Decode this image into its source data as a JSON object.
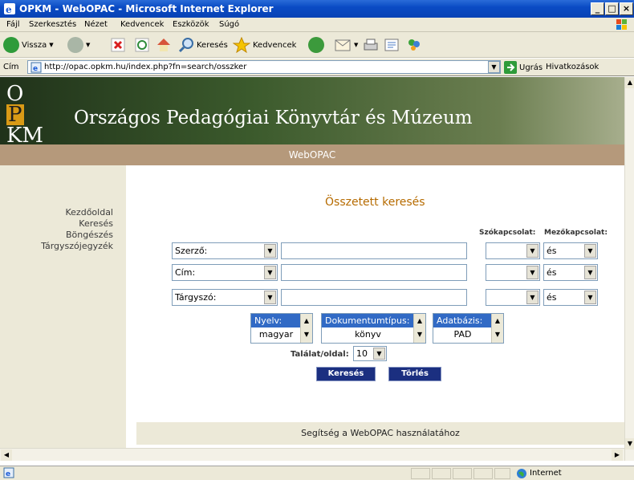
{
  "window": {
    "title": "OPKM - WebOPAC - Microsoft Internet Explorer",
    "minimize": "_",
    "maximize": "□",
    "close": "×"
  },
  "menu": {
    "items": [
      "Fájl",
      "Szerkesztés",
      "Nézet",
      "Kedvencek",
      "Eszközök",
      "Súgó"
    ]
  },
  "toolbar": {
    "back_label": "Vissza",
    "search_label": "Keresés",
    "favorites_label": "Kedvencek"
  },
  "address": {
    "label": "Cím",
    "url": "http://opac.opkm.hu/index.php?fn=search/osszker",
    "go_label": "Ugrás",
    "links_label": "Hivatkozások"
  },
  "banner": {
    "logo_top": "O",
    "logo_p": "P",
    "logo_bottom": "KM",
    "name": "Országos Pedagógiai Könyvtár és Múzeum"
  },
  "subbar": {
    "title": "WebOPAC"
  },
  "nav": {
    "items": [
      "Kezdőoldal",
      "Keresés",
      "Böngészés",
      "Tárgyszójegyzék"
    ]
  },
  "search": {
    "heading": "Összetett keresés",
    "col_szokapcsolat": "Szókapcsolat:",
    "col_mezokapcsolat": "Mezőkapcsolat:",
    "rows": [
      {
        "field": "Szerző:",
        "word_op": "",
        "field_op": "és"
      },
      {
        "field": "Cím:",
        "word_op": "",
        "field_op": "és"
      },
      {
        "field": "Tárgyszó:",
        "word_op": "",
        "field_op": "és"
      }
    ],
    "language": {
      "header": "Nyelv:",
      "value": "magyar"
    },
    "doctype": {
      "header": "Dokumentumtípus:",
      "value": "könyv"
    },
    "database": {
      "header": "Adatbázis:",
      "value": "PAD"
    },
    "per_page_label": "Találat/oldal:",
    "per_page_value": "10",
    "search_button": "Keresés",
    "clear_button": "Törlés"
  },
  "footer": {
    "help": "Segítség a WebOPAC használatához"
  },
  "status": {
    "zone": "Internet"
  },
  "colors": {
    "title_bar": "#0a4bc4",
    "banner": "#3b5a2c",
    "subbar": "#b5997b",
    "heading": "#b66b00",
    "button": "#1b2f80"
  }
}
